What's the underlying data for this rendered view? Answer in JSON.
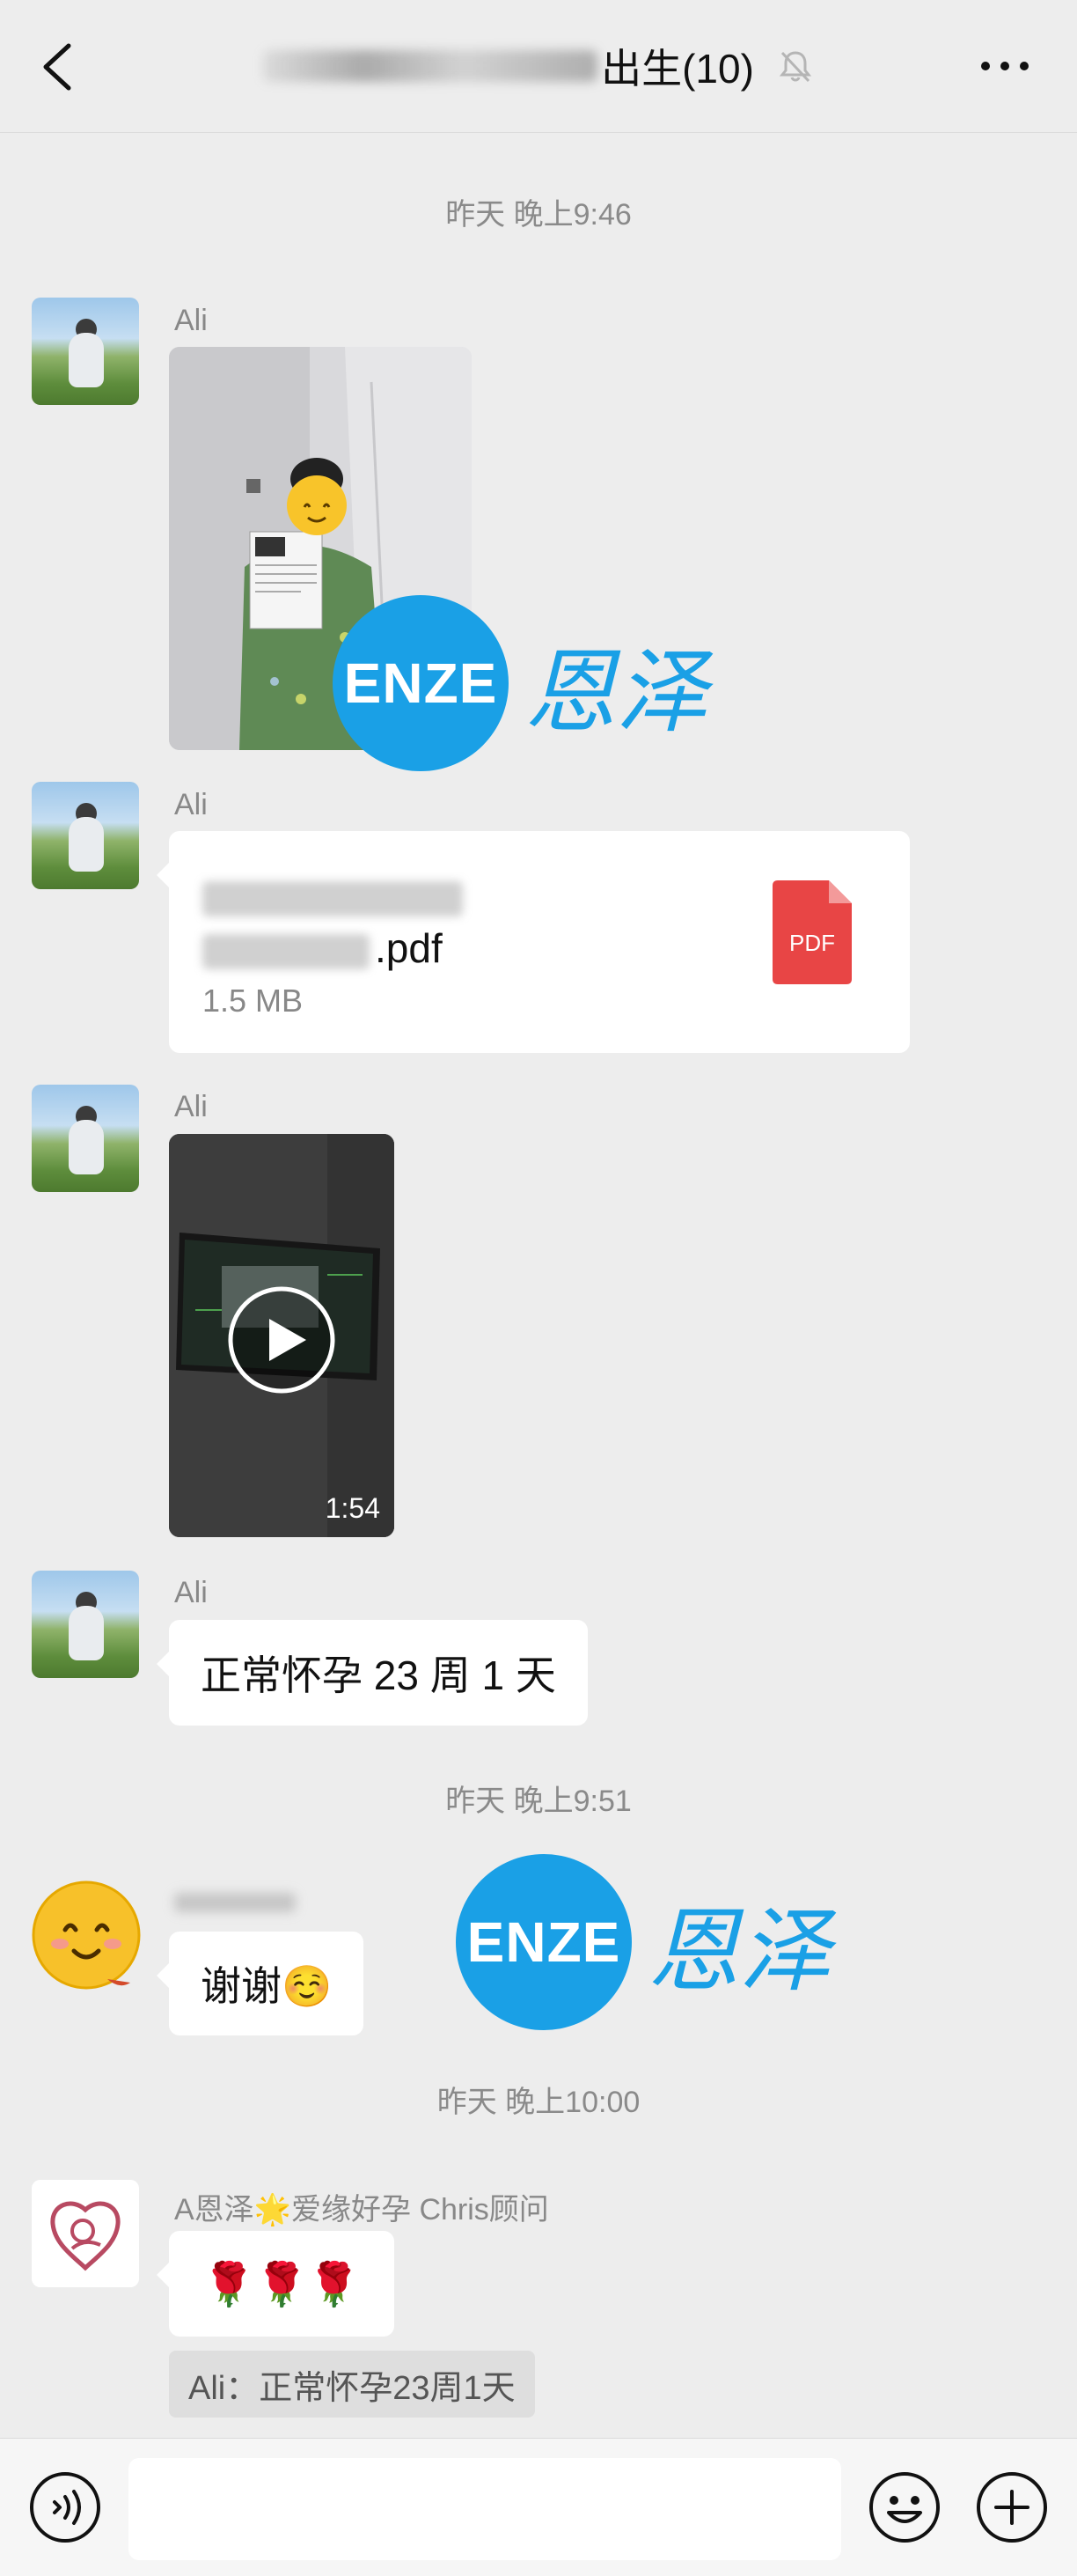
{
  "header": {
    "title": "出生(10)"
  },
  "timestamps": [
    "昨天 晚上9:46",
    "昨天 晚上9:51",
    "昨天 晚上10:00"
  ],
  "messages": {
    "m1": {
      "sender": "Ali"
    },
    "m2": {
      "sender": "Ali",
      "file_name_suffix": ".pdf",
      "file_size": "1.5 MB",
      "file_type": "PDF"
    },
    "m3": {
      "sender": "Ali",
      "duration": "1:54"
    },
    "m4": {
      "sender": "Ali",
      "text": "正常怀孕 23 周 1 天"
    },
    "m5": {
      "text": "谢谢☺️"
    },
    "m6": {
      "sender": "A恩泽🌟爱缘好孕 Chris顾问",
      "text": "🌹🌹🌹",
      "quote": "Ali：正常怀孕23周1天"
    }
  },
  "watermark": {
    "logo_text": "ENZE",
    "cn_text": "恩泽"
  },
  "input": {
    "placeholder": ""
  },
  "icons": {
    "back": "chevron-left-icon",
    "mute": "bell-off-icon",
    "more": "more-dots-icon",
    "voice": "voice-icon",
    "emoji": "emoji-icon",
    "plus": "plus-icon",
    "pdf": "pdf-file-icon",
    "play": "play-icon"
  },
  "colors": {
    "background": "#ededed",
    "bubble": "#ffffff",
    "accent_watermark": "#1aa0e6",
    "pdf_red": "#e84545"
  }
}
